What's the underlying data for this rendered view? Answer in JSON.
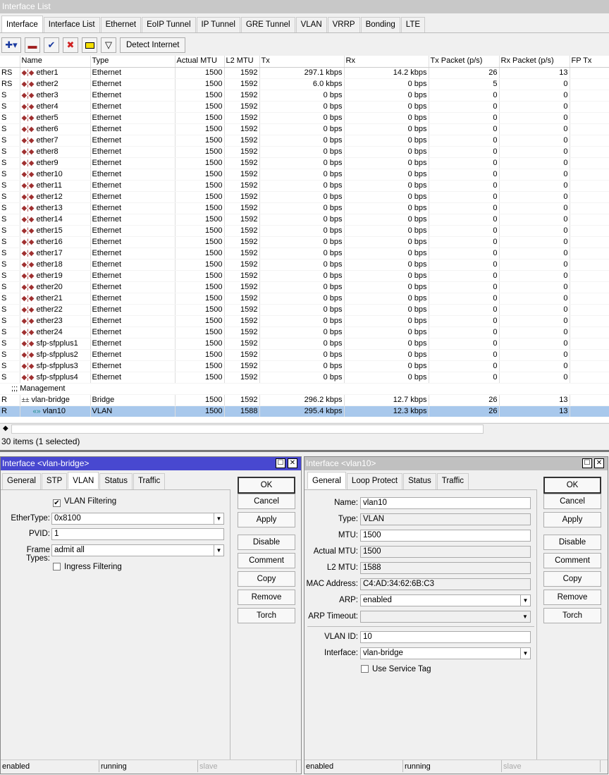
{
  "window": {
    "title": "Interface List"
  },
  "tabs": [
    "Interface",
    "Interface List",
    "Ethernet",
    "EoIP Tunnel",
    "IP Tunnel",
    "GRE Tunnel",
    "VLAN",
    "VRRP",
    "Bonding",
    "LTE"
  ],
  "toolbar": {
    "detect_label": "Detect Internet",
    "icons": [
      "add-icon",
      "remove-icon",
      "enable-icon",
      "disable-icon",
      "comment-icon",
      "filter-icon"
    ]
  },
  "columns": [
    "",
    "Name",
    "Type",
    "Actual MTU",
    "L2 MTU",
    "Tx",
    "Rx",
    "Tx Packet (p/s)",
    "Rx Packet (p/s)",
    "FP Tx"
  ],
  "rows": [
    [
      "RS",
      "ether1",
      "Ethernet",
      "1500",
      "1592",
      "297.1 kbps",
      "14.2 kbps",
      "26",
      "13"
    ],
    [
      "RS",
      "ether2",
      "Ethernet",
      "1500",
      "1592",
      "6.0 kbps",
      "0 bps",
      "5",
      "0"
    ],
    [
      "S",
      "ether3",
      "Ethernet",
      "1500",
      "1592",
      "0 bps",
      "0 bps",
      "0",
      "0"
    ],
    [
      "S",
      "ether4",
      "Ethernet",
      "1500",
      "1592",
      "0 bps",
      "0 bps",
      "0",
      "0"
    ],
    [
      "S",
      "ether5",
      "Ethernet",
      "1500",
      "1592",
      "0 bps",
      "0 bps",
      "0",
      "0"
    ],
    [
      "S",
      "ether6",
      "Ethernet",
      "1500",
      "1592",
      "0 bps",
      "0 bps",
      "0",
      "0"
    ],
    [
      "S",
      "ether7",
      "Ethernet",
      "1500",
      "1592",
      "0 bps",
      "0 bps",
      "0",
      "0"
    ],
    [
      "S",
      "ether8",
      "Ethernet",
      "1500",
      "1592",
      "0 bps",
      "0 bps",
      "0",
      "0"
    ],
    [
      "S",
      "ether9",
      "Ethernet",
      "1500",
      "1592",
      "0 bps",
      "0 bps",
      "0",
      "0"
    ],
    [
      "S",
      "ether10",
      "Ethernet",
      "1500",
      "1592",
      "0 bps",
      "0 bps",
      "0",
      "0"
    ],
    [
      "S",
      "ether11",
      "Ethernet",
      "1500",
      "1592",
      "0 bps",
      "0 bps",
      "0",
      "0"
    ],
    [
      "S",
      "ether12",
      "Ethernet",
      "1500",
      "1592",
      "0 bps",
      "0 bps",
      "0",
      "0"
    ],
    [
      "S",
      "ether13",
      "Ethernet",
      "1500",
      "1592",
      "0 bps",
      "0 bps",
      "0",
      "0"
    ],
    [
      "S",
      "ether14",
      "Ethernet",
      "1500",
      "1592",
      "0 bps",
      "0 bps",
      "0",
      "0"
    ],
    [
      "S",
      "ether15",
      "Ethernet",
      "1500",
      "1592",
      "0 bps",
      "0 bps",
      "0",
      "0"
    ],
    [
      "S",
      "ether16",
      "Ethernet",
      "1500",
      "1592",
      "0 bps",
      "0 bps",
      "0",
      "0"
    ],
    [
      "S",
      "ether17",
      "Ethernet",
      "1500",
      "1592",
      "0 bps",
      "0 bps",
      "0",
      "0"
    ],
    [
      "S",
      "ether18",
      "Ethernet",
      "1500",
      "1592",
      "0 bps",
      "0 bps",
      "0",
      "0"
    ],
    [
      "S",
      "ether19",
      "Ethernet",
      "1500",
      "1592",
      "0 bps",
      "0 bps",
      "0",
      "0"
    ],
    [
      "S",
      "ether20",
      "Ethernet",
      "1500",
      "1592",
      "0 bps",
      "0 bps",
      "0",
      "0"
    ],
    [
      "S",
      "ether21",
      "Ethernet",
      "1500",
      "1592",
      "0 bps",
      "0 bps",
      "0",
      "0"
    ],
    [
      "S",
      "ether22",
      "Ethernet",
      "1500",
      "1592",
      "0 bps",
      "0 bps",
      "0",
      "0"
    ],
    [
      "S",
      "ether23",
      "Ethernet",
      "1500",
      "1592",
      "0 bps",
      "0 bps",
      "0",
      "0"
    ],
    [
      "S",
      "ether24",
      "Ethernet",
      "1500",
      "1592",
      "0 bps",
      "0 bps",
      "0",
      "0"
    ],
    [
      "S",
      "sfp-sfpplus1",
      "Ethernet",
      "1500",
      "1592",
      "0 bps",
      "0 bps",
      "0",
      "0"
    ],
    [
      "S",
      "sfp-sfpplus2",
      "Ethernet",
      "1500",
      "1592",
      "0 bps",
      "0 bps",
      "0",
      "0"
    ],
    [
      "S",
      "sfp-sfpplus3",
      "Ethernet",
      "1500",
      "1592",
      "0 bps",
      "0 bps",
      "0",
      "0"
    ],
    [
      "S",
      "sfp-sfpplus4",
      "Ethernet",
      "1500",
      "1592",
      "0 bps",
      "0 bps",
      "0",
      "0"
    ]
  ],
  "comment": ";;; Management",
  "rows2": [
    [
      "R",
      "vlan-bridge",
      "Bridge",
      "1500",
      "1592",
      "296.2 kbps",
      "12.7 kbps",
      "26",
      "13"
    ],
    [
      "R",
      "vlan10",
      "VLAN",
      "1500",
      "1588",
      "295.4 kbps",
      "12.3 kbps",
      "26",
      "13"
    ]
  ],
  "status": "30 items (1 selected)",
  "buttons": [
    "OK",
    "Cancel",
    "Apply",
    "Disable",
    "Comment",
    "Copy",
    "Remove",
    "Torch"
  ],
  "left": {
    "title": "Interface <vlan-bridge>",
    "tabs": [
      "General",
      "STP",
      "VLAN",
      "Status",
      "Traffic"
    ],
    "vlan_filtering": "VLAN Filtering",
    "ethertype_label": "EtherType:",
    "ethertype": "0x8100",
    "pvid_label": "PVID:",
    "pvid": "1",
    "frame_label": "Frame Types:",
    "frame": "admit all",
    "ingress": "Ingress Filtering",
    "status": [
      "enabled",
      "running",
      "slave"
    ]
  },
  "right": {
    "title": "Interface <vlan10>",
    "tabs": [
      "General",
      "Loop Protect",
      "Status",
      "Traffic"
    ],
    "fields": [
      [
        "Name:",
        "vlan10"
      ],
      [
        "Type:",
        "VLAN"
      ],
      [
        "MTU:",
        "1500"
      ],
      [
        "Actual MTU:",
        "1500"
      ],
      [
        "L2 MTU:",
        "1588"
      ],
      [
        "MAC Address:",
        "C4:AD:34:62:6B:C3"
      ],
      [
        "ARP:",
        "enabled"
      ],
      [
        "ARP Timeout:",
        ""
      ]
    ],
    "vlan_id_label": "VLAN ID:",
    "vlan_id": "10",
    "iface_label": "Interface:",
    "iface": "vlan-bridge",
    "service_tag": "Use Service Tag",
    "status": [
      "enabled",
      "running",
      "slave"
    ]
  }
}
